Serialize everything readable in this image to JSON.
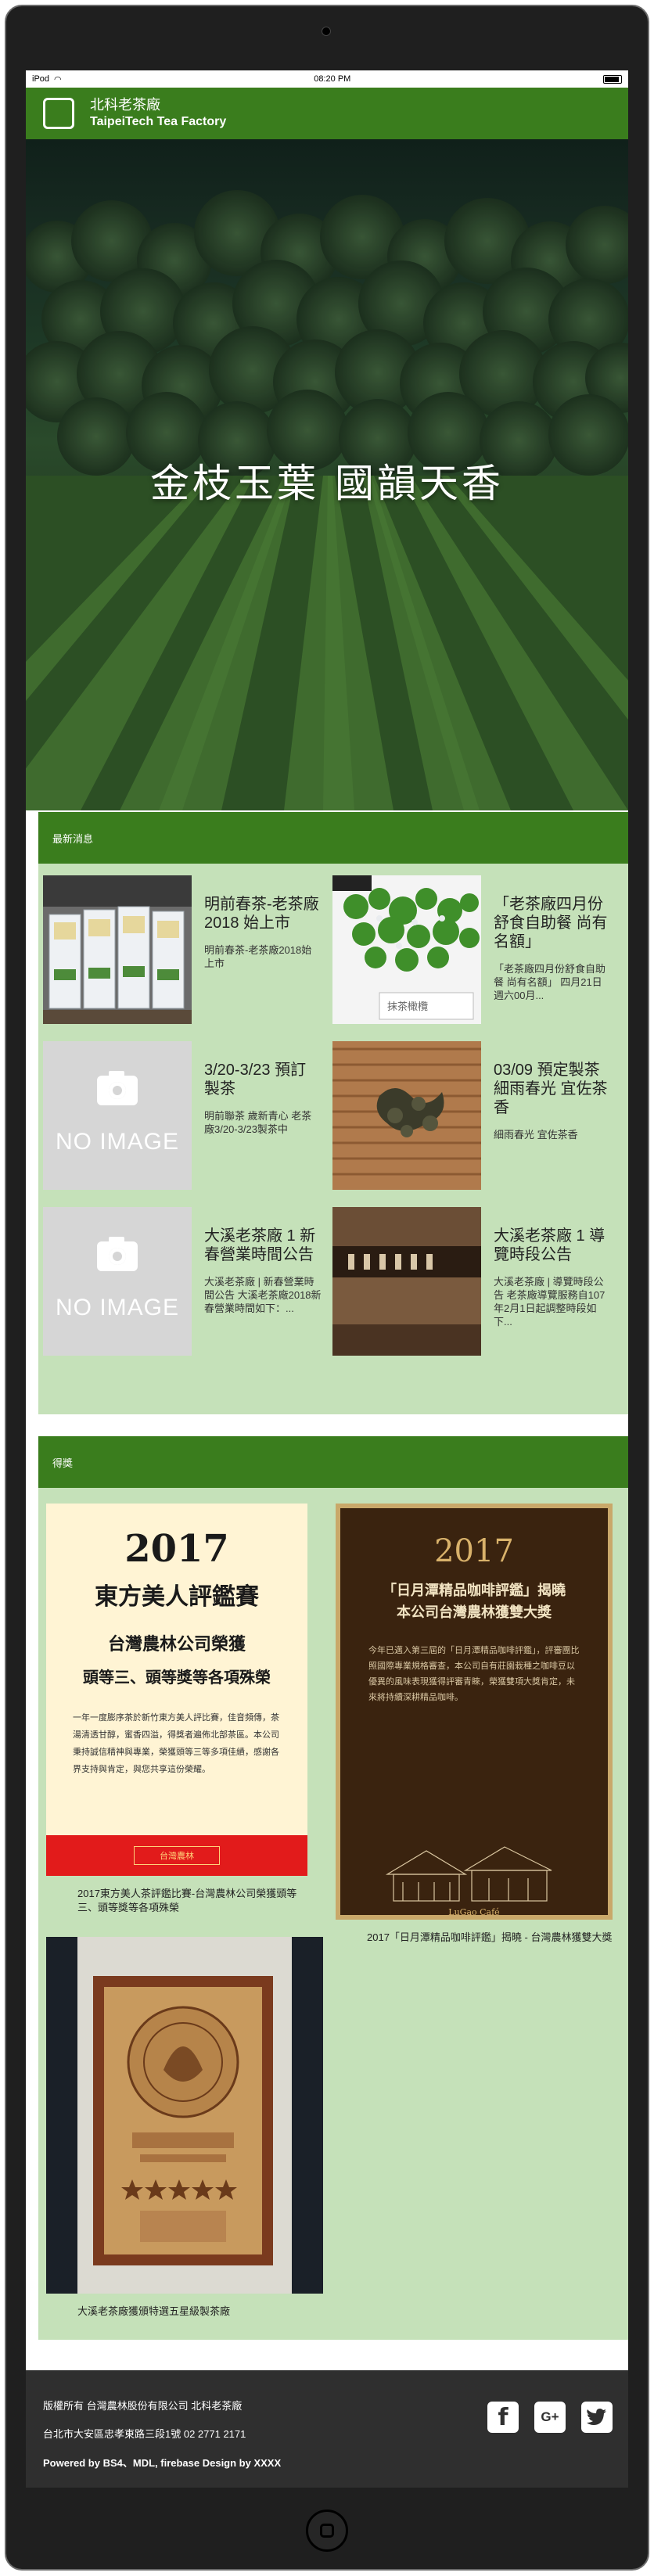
{
  "status": {
    "time": "08:20 PM",
    "carrier": "iPod"
  },
  "app": {
    "name_zh": "北科老茶廠",
    "name_en": "TaipeiTech Tea Factory"
  },
  "hero": {
    "title": "金枝玉葉 國韻天香"
  },
  "news": {
    "header": "最新消息",
    "no_image_label": "NO IMAGE",
    "items": [
      {
        "title": "明前春茶-老茶廠2018 始上市",
        "desc": "明前春茶-老茶廠2018始上市"
      },
      {
        "title": "「老茶廠四月份舒食自助餐 尚有名額」",
        "desc": "「老茶廠四月份舒食自助餐 尚有名額」 四月21日 週六00月..."
      },
      {
        "title": "3/20-3/23 預訂製茶",
        "desc": "明前聯茶 歲新青心 老茶廠3/20-3/23製茶中"
      },
      {
        "title": "03/09 預定製茶 細雨春光 宜佐茶香",
        "desc": "細雨春光 宜佐茶香"
      },
      {
        "title": "大溪老茶廠 1 新春營業時間公告",
        "desc": "大溪老茶廠 | 新春營業時間公告 大溪老茶廠2018新春營業時間如下：..."
      },
      {
        "title": "大溪老茶廠 1 導覽時段公告",
        "desc": "大溪老茶廠 | 導覽時段公告 老茶廠導覽服務自107年2月1日起調整時段如下..."
      }
    ]
  },
  "awards": {
    "header": "得獎",
    "items": [
      {
        "caption": "2017東方美人茶評鑑比賽-台灣農林公司榮獲頭等三、頭等獎等各項殊榮",
        "poster": {
          "year": "2017",
          "contest": "東方美人評鑑賽",
          "line1": "台灣農林公司榮獲",
          "line2": "頭等三、頭等獎等各項殊榮",
          "body": "一年一度膨序茶於新竹東方美人評比賽，佳音頻傳，茶湯清透甘醇，蜜香四溢，得獎者遍佈北部茶區。本公司秉持誠信精神與專業，榮獲頭等三等多項佳績，感謝各界支持與肯定，與您共享這份榮耀。",
          "seal": "台灣農林"
        }
      },
      {
        "caption": "2017「日月潭精品咖啡評鑑」揭曉 - 台灣農林獲雙大獎",
        "poster": {
          "year": "2017",
          "head": "「日月潭精品咖啡評鑑」揭曉\n本公司台灣農林獲雙大獎",
          "body": "今年已邁入第三屆的「日月潭精品咖啡評鑑」，評審團比照國際專業規格審查，本公司自有莊園栽種之咖啡豆以優異的風味表現獲得評審青睞，榮獲雙項大獎肯定，未來將持續深耕精品咖啡。",
          "cafe": "LuGao Café"
        }
      },
      {
        "caption": "大溪老茶廠獲頒特選五星級製茶廠"
      }
    ]
  },
  "footer": {
    "line1": "版權所有 台灣農林股份有限公司 北科老茶廠",
    "line2": "台北市大安區忠孝東路三段1號 02 2771 2171",
    "line3": "Powered by BS4、MDL, firebase Design by XXXX",
    "social": {
      "facebook": "f",
      "googleplus": "G+"
    }
  }
}
